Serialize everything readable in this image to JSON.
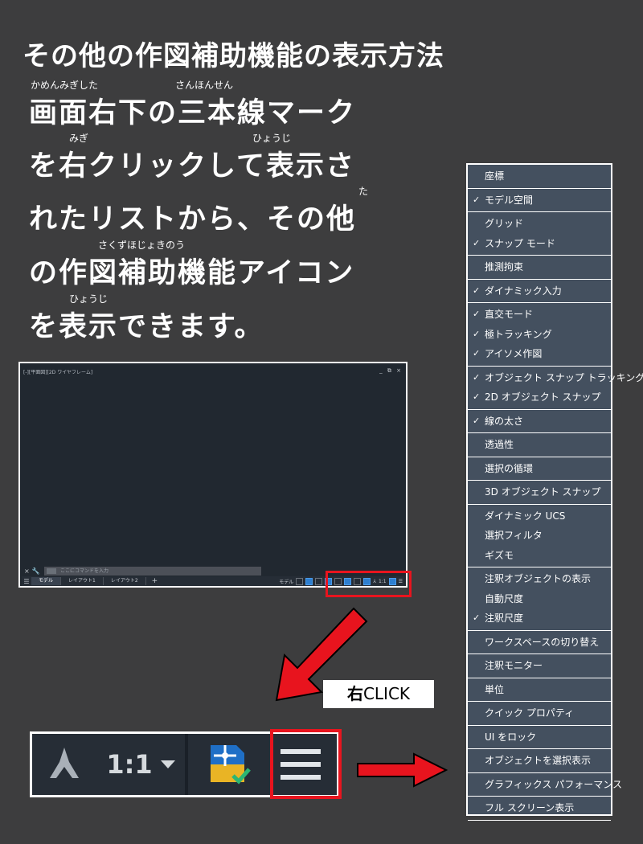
{
  "heading": "その他の作図補助機能の表示方法",
  "instructions": [
    {
      "ruby": "かめんみぎした　　　　　　　　さんほんせん",
      "text": "画面右下の三本線マーク"
    },
    {
      "ruby": "　　　　みぎ　　　　　　　　　　　　　　　　　ひょうじ",
      "text": "を右クリックして表示さ"
    },
    {
      "ruby": "　　　　　　　　　　　　　　　　　　　　　　　　　　　　　　　　　　た",
      "text": "れたリストから、その他"
    },
    {
      "ruby": "　　　　　　　さくずほじょきのう",
      "text": "の作図補助機能アイコン"
    },
    {
      "ruby": "　　　　ひょうじ",
      "text": "を表示できます。"
    }
  ],
  "autocad": {
    "title": "[-][平面図][2D ワイヤフレーム]",
    "window_buttons": "_ ⧉ ×",
    "command_placeholder": "ここにコマンドを入力",
    "tabs": [
      "モデル",
      "レイアウト1",
      "レイアウト2"
    ],
    "add_tab": "+",
    "status_model_label": "モデル",
    "status_scale": "1:1"
  },
  "callout": {
    "bold": "右",
    "text": "CLICK"
  },
  "zoom": {
    "scale": "1:1"
  },
  "colors": {
    "accent_red": "#e8141e",
    "menu_bg": "#44505f",
    "page_bg": "#3d3d3e"
  },
  "menu_groups": [
    [
      {
        "label": "座標",
        "checked": false
      }
    ],
    [
      {
        "label": "モデル空間",
        "checked": true
      }
    ],
    [
      {
        "label": "グリッド",
        "checked": false
      },
      {
        "label": "スナップ モード",
        "checked": true
      }
    ],
    [
      {
        "label": "推測拘束",
        "checked": false
      }
    ],
    [
      {
        "label": "ダイナミック入力",
        "checked": true
      }
    ],
    [
      {
        "label": "直交モード",
        "checked": true
      },
      {
        "label": "極トラッキング",
        "checked": true
      },
      {
        "label": "アイソメ作図",
        "checked": true
      }
    ],
    [
      {
        "label": "オブジェクト スナップ トラッキング",
        "checked": true
      },
      {
        "label": "2D オブジェクト スナップ",
        "checked": true
      }
    ],
    [
      {
        "label": "線の太さ",
        "checked": true
      }
    ],
    [
      {
        "label": "透過性",
        "checked": false
      }
    ],
    [
      {
        "label": "選択の循環",
        "checked": false
      }
    ],
    [
      {
        "label": "3D オブジェクト スナップ",
        "checked": false
      }
    ],
    [
      {
        "label": "ダイナミック UCS",
        "checked": false
      },
      {
        "label": "選択フィルタ",
        "checked": false
      },
      {
        "label": "ギズモ",
        "checked": false
      }
    ],
    [
      {
        "label": "注釈オブジェクトの表示",
        "checked": false
      },
      {
        "label": "自動尺度",
        "checked": false
      },
      {
        "label": "注釈尺度",
        "checked": true
      }
    ],
    [
      {
        "label": "ワークスペースの切り替え",
        "checked": false
      }
    ],
    [
      {
        "label": "注釈モニター",
        "checked": false
      }
    ],
    [
      {
        "label": "単位",
        "checked": false
      }
    ],
    [
      {
        "label": "クイック プロパティ",
        "checked": false
      }
    ],
    [
      {
        "label": "UI をロック",
        "checked": false
      }
    ],
    [
      {
        "label": "オブジェクトを選択表示",
        "checked": false
      }
    ],
    [
      {
        "label": "グラフィックス パフォーマンス",
        "checked": false
      }
    ],
    [
      {
        "label": "フル スクリーン表示",
        "checked": false
      }
    ]
  ]
}
